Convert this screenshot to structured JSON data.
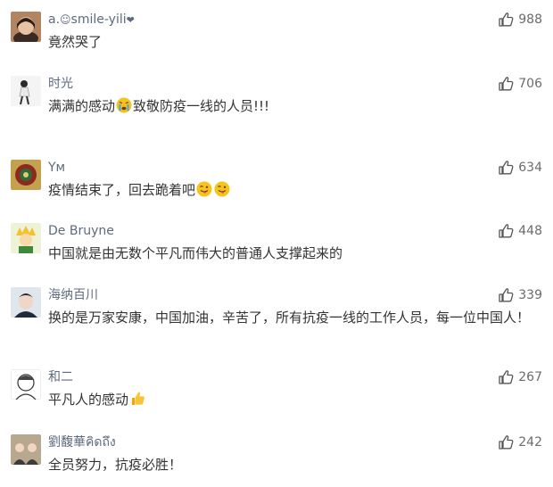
{
  "colors": {
    "username": "#5d6b7e",
    "text": "#333333",
    "like_count": "#6b6b6b",
    "background": "#ffffff"
  },
  "comments": [
    {
      "username": "a.",
      "username_suffix": "smile-yili",
      "username_icons": [
        "ghost-icon",
        "heart-icon"
      ],
      "text": "竟然哭了",
      "likes": "988",
      "like_icon": "thumbs-up-icon",
      "avatar": "avatar-woman"
    },
    {
      "username": "时光",
      "text_before": "满满的感动",
      "emoji": "crying-face-icon",
      "text_after": "致敬防疫一线的人员!!!",
      "likes": "706",
      "like_icon": "thumbs-up-icon",
      "avatar": "avatar-figure"
    },
    {
      "username": "Yм",
      "text": "疫情结束了，回去跪着吧",
      "emojis": [
        "tongue-face-icon",
        "tongue-face-icon"
      ],
      "likes": "634",
      "like_icon": "thumbs-up-icon",
      "avatar": "avatar-pattern"
    },
    {
      "username": "De Bruyne",
      "text": "中国就是由无数个平凡而伟大的普通人支撑起来的",
      "likes": "448",
      "like_icon": "thumbs-up-icon",
      "avatar": "avatar-cartoon"
    },
    {
      "username": "海纳百川",
      "text": "换的是万家安康，中国加油，辛苦了，所有抗疫一线的工作人员，每一位中国人！",
      "likes": "339",
      "like_icon": "thumbs-up-icon",
      "avatar": "avatar-man"
    },
    {
      "username": "和二",
      "text": "平凡人的感动",
      "emoji": "thumbs-up-emoji-icon",
      "likes": "267",
      "like_icon": "thumbs-up-icon",
      "avatar": "avatar-sketch"
    },
    {
      "username": "劉馥華คิดถึง",
      "text": "全员努力，抗疫必胜！",
      "likes": "242",
      "like_icon": "thumbs-up-icon",
      "avatar": "avatar-group"
    }
  ]
}
